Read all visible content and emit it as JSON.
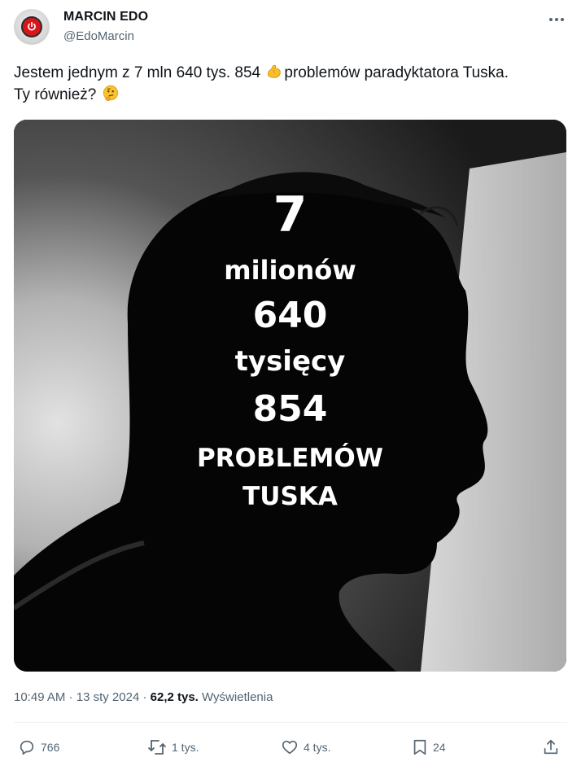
{
  "author": {
    "name": "MARCIN EDO",
    "handle": "@EdoMarcin"
  },
  "tweet": {
    "text_line1_part1": "Jestem jednym z 7 mln 640 tys. 854 ",
    "emoji_1": "💪",
    "text_line1_part2": "problemów paradyktatora Tuska.",
    "text_line2": "Ty również? ",
    "emoji_2": "🤔"
  },
  "media": {
    "overlay_lines": [
      "7",
      "milionów",
      "640",
      "tysięcy",
      "854",
      "PROBLEMÓW",
      "TUSKA"
    ]
  },
  "meta": {
    "time": "10:49 AM",
    "separator": " · ",
    "date": "13 sty 2024",
    "views_count": "62,2 tys.",
    "views_label": "Wyświetlenia"
  },
  "actions": {
    "replies": "766",
    "reposts": "1 tys.",
    "likes": "4 tys.",
    "bookmarks": "24"
  },
  "colors": {
    "text_primary": "#0f1419",
    "text_secondary": "#536471",
    "avatar_red": "#d9141a"
  },
  "icons": [
    "power-icon",
    "more-icon",
    "reply-icon",
    "repost-icon",
    "like-icon",
    "bookmark-icon",
    "share-icon"
  ]
}
